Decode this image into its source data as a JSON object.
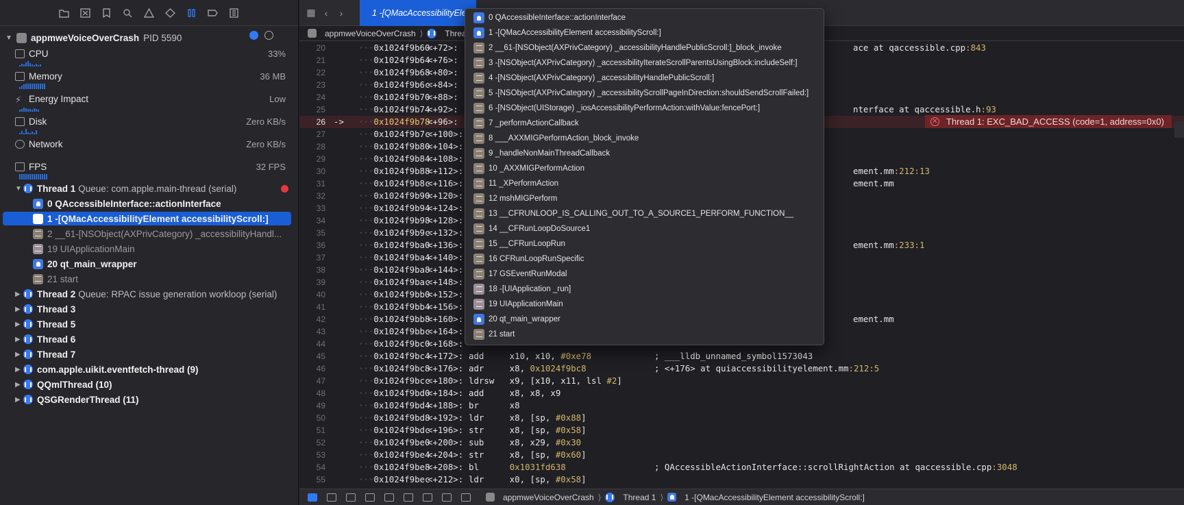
{
  "colors": {
    "accent": "#1a5ed6",
    "error": "#e0393e",
    "crash_banner_bg": "#6d2427",
    "address_highlight": "#e7c96c"
  },
  "navigator": {
    "toolbar_icons": [
      "folder-icon",
      "source-control-icon",
      "bookmark-icon",
      "find-icon",
      "issue-icon",
      "test-icon",
      "debug-icon",
      "breakpoint-icon",
      "report-icon"
    ],
    "process": {
      "name": "appmweVoiceOverCrash",
      "pid": "PID 5590"
    },
    "gauges": [
      {
        "label": "CPU",
        "value": "33%"
      },
      {
        "label": "Memory",
        "value": "36 MB"
      },
      {
        "label": "Energy Impact",
        "value": "Low"
      },
      {
        "label": "Disk",
        "value": "Zero KB/s"
      },
      {
        "label": "Network",
        "value": "Zero KB/s"
      },
      {
        "label": "FPS",
        "value": "32 FPS"
      }
    ],
    "thread1": {
      "label": "Thread 1",
      "queue": "Queue: com.apple.main-thread (serial)"
    },
    "frames": [
      {
        "label": "0 QAccessibleInterface::actionInterface"
      },
      {
        "label": "1 -[QMacAccessibilityElement accessibilityScroll:]"
      },
      {
        "label": "2 __61-[NSObject(AXPrivCategory) _accessibilityHandl..."
      },
      {
        "label": "19 UIApplicationMain"
      },
      {
        "label": "20 qt_main_wrapper"
      },
      {
        "label": "21 start"
      }
    ],
    "threads": [
      {
        "label": "Thread 2",
        "queue": "Queue: RPAC issue generation workloop (serial)"
      },
      {
        "label": "Thread 3",
        "queue": ""
      },
      {
        "label": "Thread 5",
        "queue": ""
      },
      {
        "label": "Thread 6",
        "queue": ""
      },
      {
        "label": "Thread 7",
        "queue": ""
      },
      {
        "label": "com.apple.uikit.eventfetch-thread (9)",
        "queue": ""
      },
      {
        "label": "QQmlThread (10)",
        "queue": ""
      },
      {
        "label": "QSGRenderThread (11)",
        "queue": ""
      }
    ]
  },
  "editor": {
    "tab": "1 -[QMacAccessibilityElement accessibilityScroll:]",
    "jumpbar": [
      "appmweVoiceOverCrash",
      "Thread 1"
    ],
    "crash_message": "Thread 1: EXC_BAD_ACCESS (code=1, address=0x0)",
    "lines": [
      {
        "n": "20",
        "addr": "0x1024f9b60",
        "off": "<+72>:",
        "tail": "ace at qaccessible.cpp:843"
      },
      {
        "n": "21",
        "addr": "0x1024f9b64",
        "off": "<+76>:",
        "tail": ""
      },
      {
        "n": "22",
        "addr": "0x1024f9b68",
        "off": "<+80>:",
        "tail": ""
      },
      {
        "n": "23",
        "addr": "0x1024f9b6c",
        "off": "<+84>:",
        "tail": ""
      },
      {
        "n": "24",
        "addr": "0x1024f9b70",
        "off": "<+88>:",
        "tail": ""
      },
      {
        "n": "25",
        "addr": "0x1024f9b74",
        "off": "<+92>:",
        "tail": "nterface at qaccessible.h:93"
      },
      {
        "n": "26",
        "addr": "0x1024f9b78",
        "off": "<+96>:",
        "tail": ""
      },
      {
        "n": "27",
        "addr": "0x1024f9b7c",
        "off": "<+100>:",
        "tail": ""
      },
      {
        "n": "28",
        "addr": "0x1024f9b80",
        "off": "<+104>:",
        "tail": ""
      },
      {
        "n": "29",
        "addr": "0x1024f9b84",
        "off": "<+108>:",
        "tail": ""
      },
      {
        "n": "30",
        "addr": "0x1024f9b88",
        "off": "<+112>:",
        "tail": "ement.mm:212:13"
      },
      {
        "n": "31",
        "addr": "0x1024f9b8c",
        "off": "<+116>:",
        "tail": "ement.mm"
      },
      {
        "n": "32",
        "addr": "0x1024f9b90",
        "off": "<+120>:",
        "tail": ""
      },
      {
        "n": "33",
        "addr": "0x1024f9b94",
        "off": "<+124>:",
        "tail": ""
      },
      {
        "n": "34",
        "addr": "0x1024f9b98",
        "off": "<+128>:",
        "tail": ""
      },
      {
        "n": "35",
        "addr": "0x1024f9b9c",
        "off": "<+132>:",
        "tail": ""
      },
      {
        "n": "36",
        "addr": "0x1024f9ba0",
        "off": "<+136>:",
        "tail": "ement.mm:233:1"
      },
      {
        "n": "37",
        "addr": "0x1024f9ba4",
        "off": "<+140>:",
        "tail": ""
      },
      {
        "n": "38",
        "addr": "0x1024f9ba8",
        "off": "<+144>:",
        "tail": ""
      },
      {
        "n": "39",
        "addr": "0x1024f9bac",
        "off": "<+148>:",
        "tail": ""
      },
      {
        "n": "40",
        "addr": "0x1024f9bb0",
        "off": "<+152>:",
        "tail": ""
      },
      {
        "n": "41",
        "addr": "0x1024f9bb4",
        "off": "<+156>:",
        "tail": ""
      },
      {
        "n": "42",
        "addr": "0x1024f9bb8",
        "off": "<+160>:",
        "tail": "ement.mm"
      },
      {
        "n": "43",
        "addr": "0x1024f9bbc",
        "off": "<+164>:",
        "tail": ""
      },
      {
        "n": "44",
        "addr": "0x1024f9bc0",
        "off": "<+168>:",
        "tail": ""
      },
      {
        "n": "45",
        "addr": "0x1024f9bc4",
        "off": "<+172>:",
        "instr": "add     x10, x10, #0xe78",
        "comment": "; ___lldb_unnamed_symbol1573043"
      },
      {
        "n": "46",
        "addr": "0x1024f9bc8",
        "off": "<+176>:",
        "instr": "adr     x8, 0x1024f9bc8",
        "comment": "; <+176> at quiaccessibilityelement.mm:212:5"
      },
      {
        "n": "47",
        "addr": "0x1024f9bcc",
        "off": "<+180>:",
        "instr": "ldrsw   x9, [x10, x11, lsl #2]"
      },
      {
        "n": "48",
        "addr": "0x1024f9bd0",
        "off": "<+184>:",
        "instr": "add     x8, x8, x9"
      },
      {
        "n": "49",
        "addr": "0x1024f9bd4",
        "off": "<+188>:",
        "instr": "br      x8"
      },
      {
        "n": "50",
        "addr": "0x1024f9bd8",
        "off": "<+192>:",
        "instr": "ldr     x8, [sp, #0x88]"
      },
      {
        "n": "51",
        "addr": "0x1024f9bdc",
        "off": "<+196>:",
        "instr": "str     x8, [sp, #0x58]"
      },
      {
        "n": "52",
        "addr": "0x1024f9be0",
        "off": "<+200>:",
        "instr": "sub     x8, x29, #0x30"
      },
      {
        "n": "53",
        "addr": "0x1024f9be4",
        "off": "<+204>:",
        "instr": "str     x8, [sp, #0x60]"
      },
      {
        "n": "54",
        "addr": "0x1024f9be8",
        "off": "<+208>:",
        "instr": "bl      0x1031fd638",
        "comment": "; QAccessibleActionInterface::scrollRightAction at qaccessible.cpp:3048"
      },
      {
        "n": "55",
        "addr": "0x1024f9bec",
        "off": "<+212>:",
        "instr": "ldr     x0, [sp, #0x58]"
      }
    ]
  },
  "popup": {
    "frames": [
      {
        "label": "0 QAccessibleInterface::actionInterface",
        "kind": "user"
      },
      {
        "label": "1 -[QMacAccessibilityElement accessibilityScroll:]",
        "kind": "user"
      },
      {
        "label": "2 __61-[NSObject(AXPrivCategory) _accessibilityHandlePublicScroll:]_block_invoke",
        "kind": "sys"
      },
      {
        "label": "3 -[NSObject(AXPrivCategory) _accessibilityIterateScrollParentsUsingBlock:includeSelf:]",
        "kind": "sys"
      },
      {
        "label": "4 -[NSObject(AXPrivCategory) _accessibilityHandlePublicScroll:]",
        "kind": "sys"
      },
      {
        "label": "5 -[NSObject(AXPrivCategory) _accessibilityScrollPageInDirection:shouldSendScrollFailed:]",
        "kind": "sys"
      },
      {
        "label": "6 -[NSObject(UIStorage) _iosAccessibilityPerformAction:withValue:fencePort:]",
        "kind": "sys"
      },
      {
        "label": "7 _performActionCallback",
        "kind": "sys"
      },
      {
        "label": "8 ___AXXMIGPerformAction_block_invoke",
        "kind": "sys"
      },
      {
        "label": "9 _handleNonMainThreadCallback",
        "kind": "sys"
      },
      {
        "label": "10 _AXXMIGPerformAction",
        "kind": "sys"
      },
      {
        "label": "11 _XPerformAction",
        "kind": "sys"
      },
      {
        "label": "12 mshMIGPerform",
        "kind": "sys"
      },
      {
        "label": "13 __CFRUNLOOP_IS_CALLING_OUT_TO_A_SOURCE1_PERFORM_FUNCTION__",
        "kind": "sys"
      },
      {
        "label": "14 __CFRunLoopDoSource1",
        "kind": "sys"
      },
      {
        "label": "15 __CFRunLoopRun",
        "kind": "sys"
      },
      {
        "label": "16 CFRunLoopRunSpecific",
        "kind": "sys"
      },
      {
        "label": "17 GSEventRunModal",
        "kind": "sys"
      },
      {
        "label": "18 -[UIApplication _run]",
        "kind": "lib"
      },
      {
        "label": "19 UIApplicationMain",
        "kind": "lib"
      },
      {
        "label": "20 qt_main_wrapper",
        "kind": "user"
      },
      {
        "label": "21 start",
        "kind": "sys"
      }
    ]
  },
  "debugbar": {
    "crumbs": [
      "appmweVoiceOverCrash",
      "Thread 1",
      "1 -[QMacAccessibilityElement accessibilityScroll:]"
    ]
  }
}
